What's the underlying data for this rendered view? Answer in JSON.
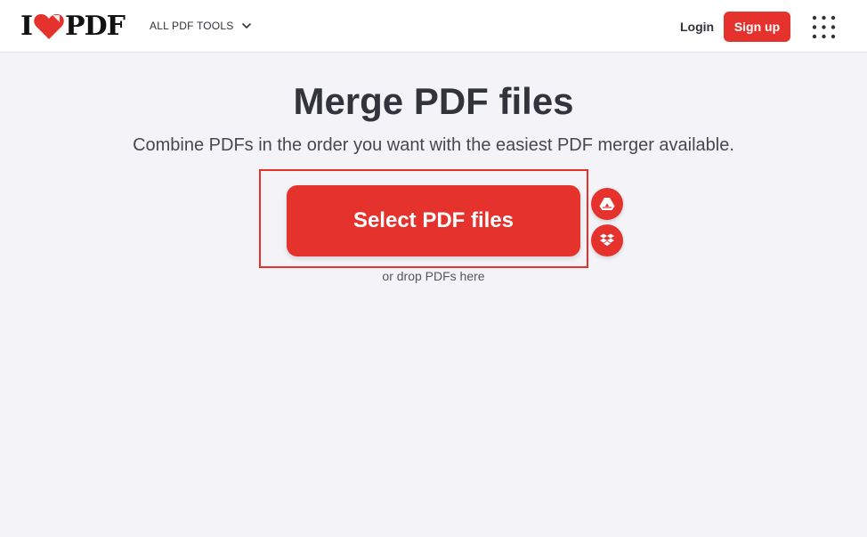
{
  "header": {
    "logo_left": "I",
    "logo_right": "PDF",
    "all_tools_label": "ALL PDF TOOLS",
    "login_label": "Login",
    "signup_label": "Sign up",
    "accent_color": "#e5322d"
  },
  "main": {
    "title": "Merge PDF files",
    "subtitle": "Combine PDFs in the order you want with the easiest PDF merger available.",
    "select_button_label": "Select PDF files",
    "drop_hint": "or drop PDFs here",
    "cloud_buttons": [
      {
        "icon": "google-drive-icon"
      },
      {
        "icon": "dropbox-icon"
      }
    ]
  }
}
